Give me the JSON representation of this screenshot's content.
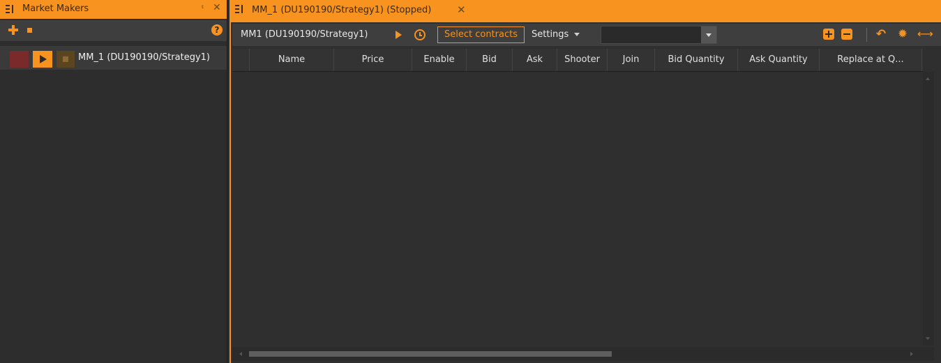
{
  "left_panel": {
    "title": "Market Makers",
    "pin_glyph": "ᵗ",
    "close_glyph": "✕",
    "toolbar": {
      "add_icon": "plus-icon",
      "stop_icon": "stop-icon",
      "help_glyph": "?"
    },
    "items": [
      {
        "label": "MM_1 (DU190190/Strategy1)"
      }
    ]
  },
  "tab": {
    "title": "MM_1 (DU190190/Strategy1) (Stopped)",
    "close_glyph": "✕"
  },
  "toolbar": {
    "name": "MM1 (DU190190/Strategy1)",
    "select_contracts": "Select contracts",
    "settings": "Settings",
    "combo_value": "",
    "undo_glyph": "↶",
    "gear_glyph": "✹",
    "expand_glyph": "⟷"
  },
  "grid": {
    "columns": [
      "Name",
      "Price",
      "Enable",
      "Bid",
      "Ask",
      "Shooter",
      "Join",
      "Bid Quantity",
      "Ask Quantity",
      "Replace at Q..."
    ],
    "rows": []
  },
  "colors": {
    "accent": "#f7931e",
    "background": "#2f2f2f",
    "toolbar": "#3e3e3e",
    "stop_red": "#7a2a2a"
  }
}
